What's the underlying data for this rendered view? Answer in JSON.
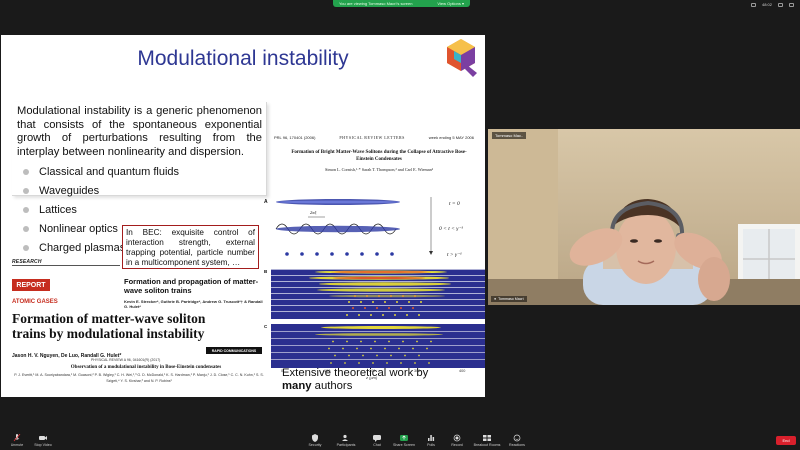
{
  "topbar": {
    "share_notice": "You are viewing Tommaso Macrì's screen",
    "view_options": "View Options ▾",
    "time": "48:02"
  },
  "slide": {
    "title": "Modulational instability",
    "definition": "Modulational instability is a generic phenomenon that consists of the spontaneous exponential growth of perturbations resulting from the interplay between nonlinearity and dispersion.",
    "bullets": [
      "Classical and quantum fluids",
      "Waveguides",
      "Lattices",
      "Nonlinear optics",
      "Charged plasmas"
    ],
    "bec_note": "In BEC: exquisite control of interaction strength, external trapping potential, particle number in a multicomponent system, …",
    "research_label": "RESEARCH",
    "report_label": "REPORT",
    "atomic_gases": "ATOMIC GASES",
    "main_paper_title": "Formation of matter-wave soliton trains by modulational instability",
    "main_paper_authors": "Jason H. V. Nguyen, De Luo, Randall G. Hulet*",
    "fp_title": "Formation and propagation of matter-wave soliton trains",
    "fp_authors": "Kevin E. Strecker*, Guthrie B. Partridge*, Andrew G. Truscott*† & Randall G. Hulet*",
    "rapid_comm": "RAPID COMMUNICATIONS",
    "pra_citation": "PHYSICAL REVIEW A 96, 041601(R) (2017)",
    "obs_title": "Observation of a modulational instability in Bose-Einstein condensates",
    "obs_authors": "P. J. Everitt,¹ M. A. Sooriyabandara,¹ M. Guasoni,² P. B. Wigley,¹ C. H. Wei,¹,³ G. D. McDonald,¹ K. S. Hardman,¹ P. Manju,¹ J. D. Close,¹ C. C. N. Kuhn,¹ S. S. Szigeti,⁴ Y. S. Kivshar,³ and N. P. Robins¹",
    "prl_citation": "PRL 96, 170401 (2006)",
    "prl_journal": "PHYSICAL REVIEW LETTERS",
    "prl_week": "week ending 5 MAY 2006",
    "prl_title": "Formation of Bright Matter-Wave Solitons during the Collapse of Attractive Bose-Einstein Condensates",
    "prl_authors": "Simon L. Cornish,¹·* Sarah T. Thompson,² and Carl E. Wieman²",
    "fig_t0": "t = 0",
    "fig_t1": "0 < t < γ⁻¹",
    "fig_t2": "t > γ⁻¹",
    "fig_two_xi": "2πξ",
    "x_axis_label": "z (μm)",
    "x_ticks": [
      "0",
      "100",
      "200",
      "300",
      "400"
    ],
    "extensive_prefix": "Extensive theoretical work by",
    "extensive_bold": "many",
    "extensive_suffix": "authors"
  },
  "camera": {
    "top_name": "Tommaso Mac..",
    "bottom_name": "Tommaso Macrì"
  },
  "toolbar": {
    "items": [
      "Unmute",
      "Stop Video",
      "Security",
      "Participants",
      "Chat",
      "Share Screen",
      "Polls",
      "Record",
      "Breakout Rooms",
      "Reactions"
    ],
    "participants_count": "42",
    "end_label": "End"
  },
  "colors": {
    "title_blue": "#2e3793",
    "report_red": "#c62d1f",
    "share_green": "#23a24d",
    "end_red": "#d9202c"
  }
}
